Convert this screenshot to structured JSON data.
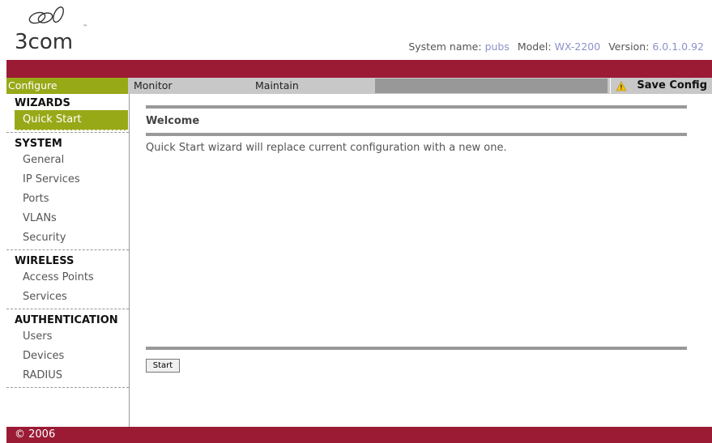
{
  "brand": {
    "logo_text": "3com",
    "trademark": "™"
  },
  "system_info": {
    "name_label": "System name:",
    "name_value": "pubs",
    "model_label": "Model:",
    "model_value": "WX-2200",
    "version_label": "Version:",
    "version_value": "6.0.1.0.92"
  },
  "nav": {
    "tabs": [
      {
        "label": "Configure",
        "active": true
      },
      {
        "label": "Monitor",
        "active": false
      },
      {
        "label": "Maintain",
        "active": false
      }
    ],
    "save_config": "Save Config",
    "save_icon": "warning-icon"
  },
  "sidebar": {
    "sections": [
      {
        "title": "WIZARDS",
        "items": [
          "Quick Start"
        ]
      },
      {
        "title": "SYSTEM",
        "items": [
          "General",
          "IP Services",
          "Ports",
          "VLANs",
          "Security"
        ]
      },
      {
        "title": "WIRELESS",
        "items": [
          "Access Points",
          "Services"
        ]
      },
      {
        "title": "AUTHENTICATION",
        "items": [
          "Users",
          "Devices",
          "RADIUS"
        ]
      }
    ],
    "active_item": "Quick Start"
  },
  "main": {
    "heading": "Welcome",
    "intro": "Quick Start wizard will replace current configuration with a new one.",
    "start_label": "Start"
  },
  "footer": {
    "copyright": "© 2006"
  },
  "colors": {
    "brand_red": "#9b1b35",
    "accent_green": "#98a918",
    "value_blue": "#8c92c8",
    "nav_gray": "#c8c8c8"
  }
}
